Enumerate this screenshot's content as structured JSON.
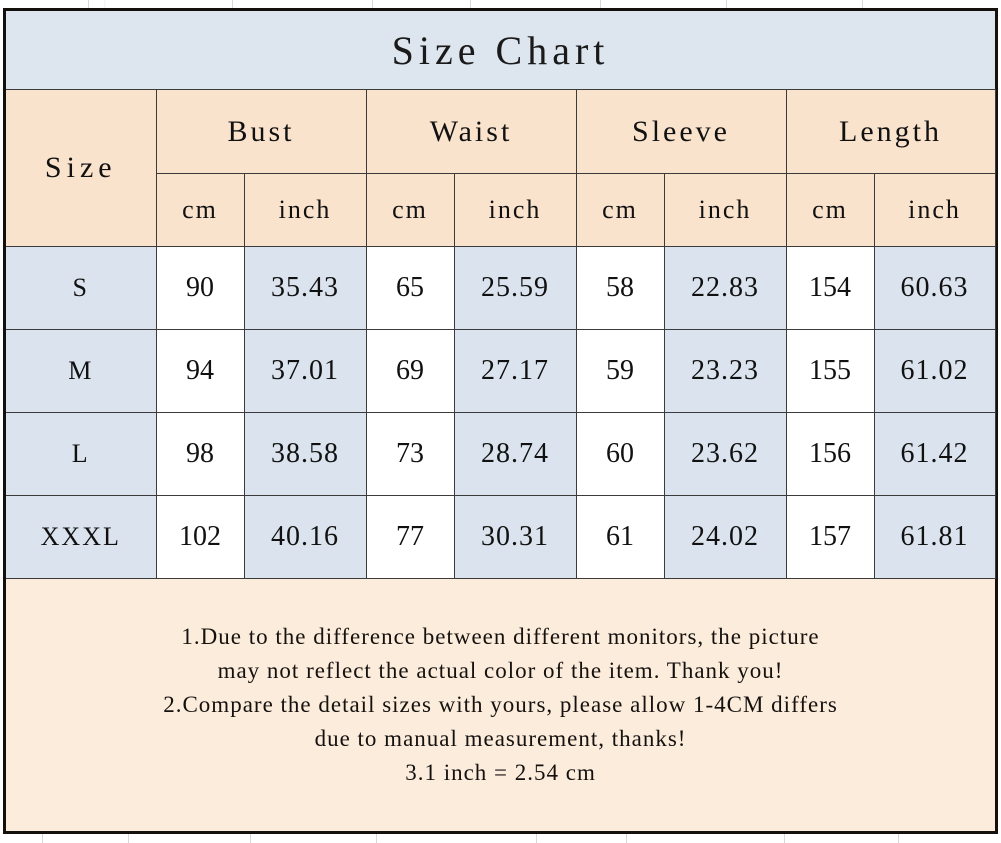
{
  "title": "Size Chart",
  "table": {
    "size_header": "Size",
    "measure_groups": [
      "Bust",
      "Waist",
      "Sleeve",
      "Length"
    ],
    "unit_headers": [
      "cm",
      "inch",
      "cm",
      "inch",
      "cm",
      "inch",
      "cm",
      "inch"
    ],
    "rows": [
      {
        "size": "S",
        "bust_cm": "90",
        "bust_inch": "35.43",
        "waist_cm": "65",
        "waist_inch": "25.59",
        "sleeve_cm": "58",
        "sleeve_inch": "22.83",
        "length_cm": "154",
        "length_inch": "60.63"
      },
      {
        "size": "M",
        "bust_cm": "94",
        "bust_inch": "37.01",
        "waist_cm": "69",
        "waist_inch": "27.17",
        "sleeve_cm": "59",
        "sleeve_inch": "23.23",
        "length_cm": "155",
        "length_inch": "61.02"
      },
      {
        "size": "L",
        "bust_cm": "98",
        "bust_inch": "38.58",
        "waist_cm": "73",
        "waist_inch": "28.74",
        "sleeve_cm": "60",
        "sleeve_inch": "23.62",
        "length_cm": "156",
        "length_inch": "61.42"
      },
      {
        "size": "XXXL",
        "bust_cm": "102",
        "bust_inch": "40.16",
        "waist_cm": "77",
        "waist_inch": "30.31",
        "sleeve_cm": "61",
        "sleeve_inch": "24.02",
        "length_cm": "157",
        "length_inch": "61.81"
      }
    ]
  },
  "notes": {
    "line1": "1.Due to the difference between different monitors, the picture",
    "line2": "may not reflect the actual color of the item. Thank you!",
    "line3": "2.Compare the detail sizes with yours, please allow 1-4CM differs",
    "line4": "due to manual measurement, thanks!",
    "line5": "3.1 inch = 2.54 cm"
  },
  "colors": {
    "title_background": "#dde5ef",
    "header_background": "#fae3cd",
    "notes_background": "#fbecdc",
    "cm_cell_background": "#ffffff",
    "inch_cell_background": "#dbe4ee",
    "size_cell_background": "#dbe4ee",
    "border": "#3b3b3b",
    "outer_border": "#14100c",
    "text": "#111111"
  }
}
